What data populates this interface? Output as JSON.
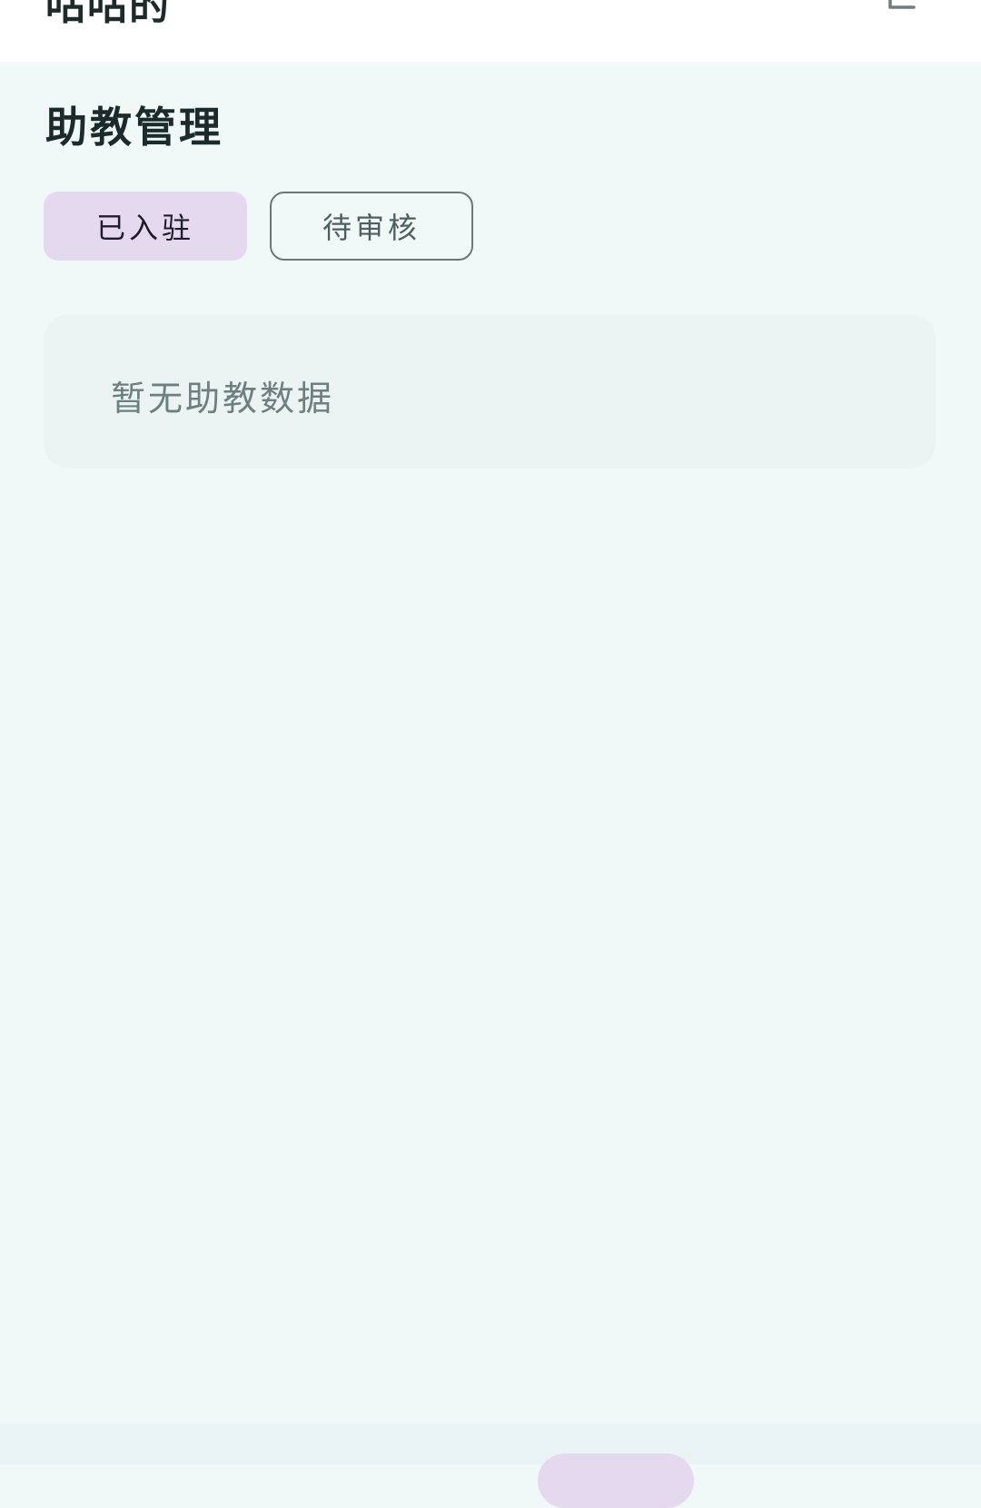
{
  "app_header": {
    "title": "咕咕的",
    "logout_icon": "logout-icon"
  },
  "page": {
    "title": "助教管理"
  },
  "tabs": [
    {
      "label": "已入驻",
      "active": true
    },
    {
      "label": "待审核",
      "active": false
    }
  ],
  "empty_state": {
    "message": "暂无助教数据"
  },
  "colors": {
    "background": "#f1f8f8",
    "header_background": "#ffffff",
    "accent": "#e5d9ef",
    "card_background": "#ebf3f3",
    "title_text": "#1b2a2a",
    "muted_text": "#6d7f7f",
    "tab_border": "#6f7676"
  },
  "bottom_nav": {
    "active_indicator_icon": "nav-pill"
  }
}
